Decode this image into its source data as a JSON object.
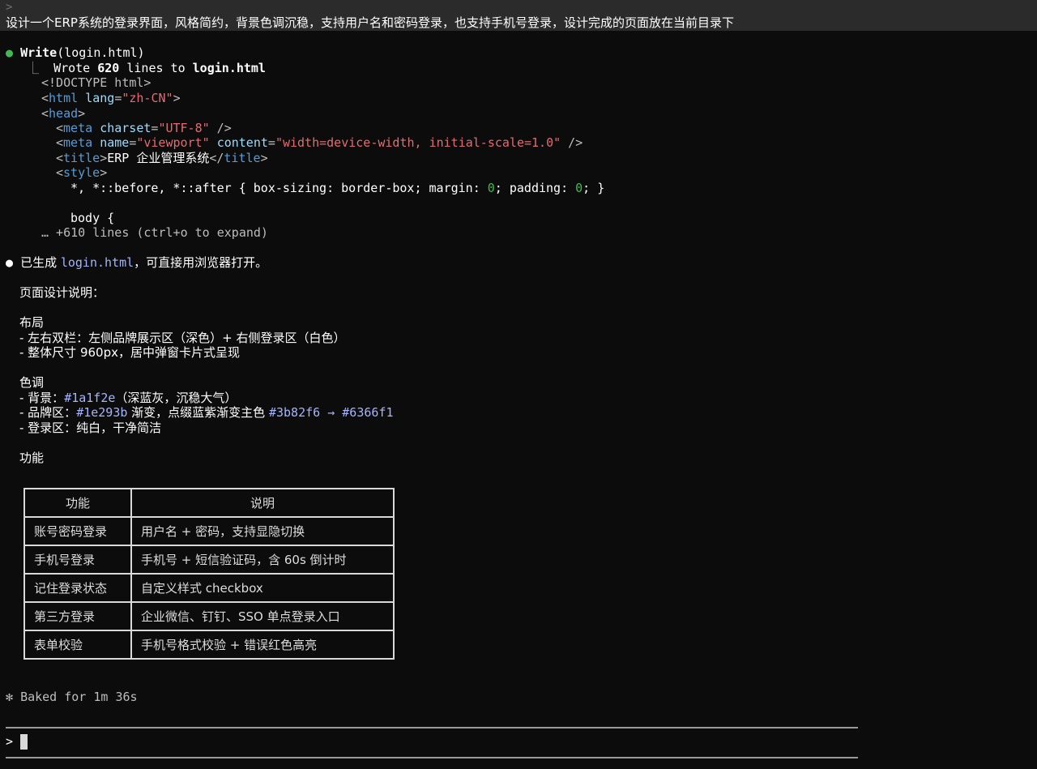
{
  "prompt": {
    "caret": ">",
    "text": "设计一个ERP系统的登录界面，风格简约，背景色调沉稳，支持用户名和密码登录，也支持手机号登录，设计完成的页面放在当前目录下"
  },
  "tool_call": {
    "bullet": "●",
    "name": "Write",
    "arg": "(login.html)",
    "result_prefix": "⎿  ",
    "result_wrote": "Wrote ",
    "result_count": "620",
    "result_mid": " lines to ",
    "result_file": "login.html",
    "code_lines": [
      "<!DOCTYPE html>",
      "<html lang=\"zh-CN\">",
      "<head>",
      "<meta charset=\"UTF-8\" />",
      "<meta name=\"viewport\" content=\"width=device-width, initial-scale=1.0\" />",
      "<title>ERP 企业管理系统</title>",
      "<style>",
      "*, *::before, *::after { box-sizing: border-box; margin: 0; padding: 0; }",
      "body {"
    ],
    "expand_hint": "… +610 lines (ctrl+o to expand)"
  },
  "response": {
    "bullet": "●",
    "intro_a": "已生成 ",
    "intro_file": "login.html",
    "intro_b": "，可直接用浏览器打开。",
    "section_title": "页面设计说明：",
    "layout_heading": "布局",
    "layout_items": [
      "- 左右双栏：左侧品牌展示区（深色）+ 右侧登录区（白色）",
      "- 整体尺寸 960px，居中弹窗卡片式呈现"
    ],
    "color_heading": "色调",
    "color_bg_a": "- 背景：",
    "color_bg_hex": "#1a1f2e",
    "color_bg_b": "（深蓝灰，沉稳大气）",
    "color_brand_a": "- 品牌区：",
    "color_brand_hex": "#1e293b",
    "color_brand_b": " 渐变，点缀蓝紫渐变主色 ",
    "color_brand_hex2": "#3b82f6",
    "color_brand_arrow": " → ",
    "color_brand_hex3": "#6366f1",
    "color_login": "- 登录区：纯白，干净简洁",
    "feature_heading": "功能",
    "table": {
      "headers": [
        "功能",
        "说明"
      ],
      "rows": [
        [
          "账号密码登录",
          "用户名 + 密码，支持显隐切换"
        ],
        [
          "手机号登录",
          "手机号 + 短信验证码，含 60s 倒计时"
        ],
        [
          "记住登录状态",
          "自定义样式 checkbox"
        ],
        [
          "第三方登录",
          "企业微信、钉钉、SSO 单点登录入口"
        ],
        [
          "表单校验",
          "手机号格式校验 + 错误红色高亮"
        ]
      ]
    }
  },
  "status": {
    "icon": "✻",
    "text": "Baked for 1m 36s"
  },
  "input": {
    "caret": ">"
  },
  "colors": {
    "background": "#0c0c0c",
    "prompt_bar": "#2b2b2b",
    "bullet_success": "#3fb950",
    "tag": "#569cd6",
    "attr": "#9cdcfe",
    "string": "#e06c75",
    "file_accent": "#a5b4fc"
  }
}
